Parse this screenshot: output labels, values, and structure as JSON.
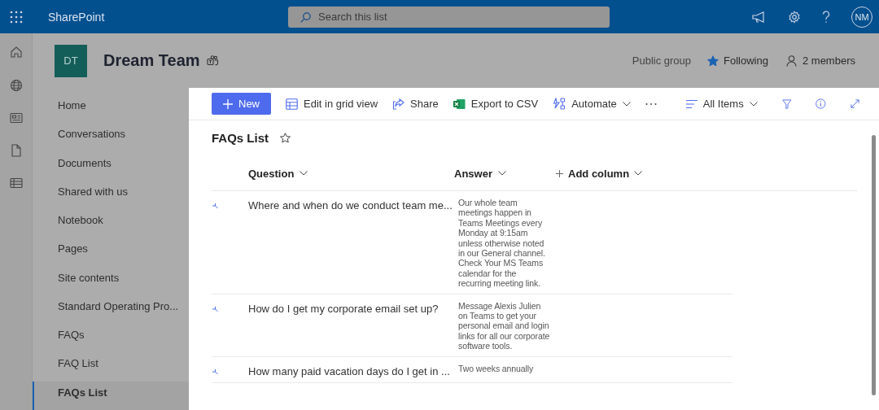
{
  "app_bar": {
    "title": "SharePoint",
    "search": {
      "placeholder": "Search this list"
    },
    "avatar": "NM"
  },
  "site": {
    "logo": "DT",
    "title": "Dream Team",
    "privacy": "Public group",
    "follow": {
      "label": "Following",
      "on": true
    },
    "members": "2 members"
  },
  "rail": [
    {
      "kind": "home"
    },
    {
      "kind": "globe"
    },
    {
      "kind": "news"
    },
    {
      "kind": "file"
    },
    {
      "kind": "list"
    }
  ],
  "nav": [
    {
      "label": "Home",
      "selected": false
    },
    {
      "label": "Conversations",
      "selected": false
    },
    {
      "label": "Documents",
      "selected": false
    },
    {
      "label": "Shared with us",
      "selected": false
    },
    {
      "label": "Notebook",
      "selected": false
    },
    {
      "label": "Pages",
      "selected": false
    },
    {
      "label": "Site contents",
      "selected": false
    },
    {
      "label": "Standard Operating Pro...",
      "selected": false
    },
    {
      "label": "FAQs",
      "selected": false
    },
    {
      "label": "FAQ List",
      "selected": false
    },
    {
      "label": "FAQs List",
      "selected": true
    }
  ],
  "commands": [
    {
      "kind": "new",
      "label": "New"
    },
    {
      "kind": "grid",
      "label": "Edit in grid view"
    },
    {
      "kind": "share",
      "label": "Share"
    },
    {
      "kind": "excel",
      "label": "Export to CSV"
    },
    {
      "kind": "automate",
      "label": "Automate"
    },
    {
      "kind": "more"
    }
  ],
  "view": {
    "label": "All Items"
  },
  "list": {
    "title": "FAQs List",
    "favorite": false,
    "columns": [
      {
        "kind": "field",
        "label": "Question"
      },
      {
        "kind": "field",
        "label": "Answer"
      },
      {
        "kind": "add",
        "label": "Add column"
      }
    ],
    "rows": [
      {
        "question": "Where and when do we conduct team me...",
        "answer": "Our whole team meetings happen in Teams Meetings every Monday at 9:15am unless otherwise noted in our General channel. Check Your MS Teams calendar for the recurring meeting link.",
        "new": true
      },
      {
        "question": "How do I get my corporate email set up?",
        "answer": "Message Alexis Julien on Teams to get your personal email and login links for all our corporate software tools.",
        "new": true
      },
      {
        "question": "How many paid vacation days do I get in ...",
        "answer": "Two weeks annually",
        "new": true
      }
    ]
  }
}
